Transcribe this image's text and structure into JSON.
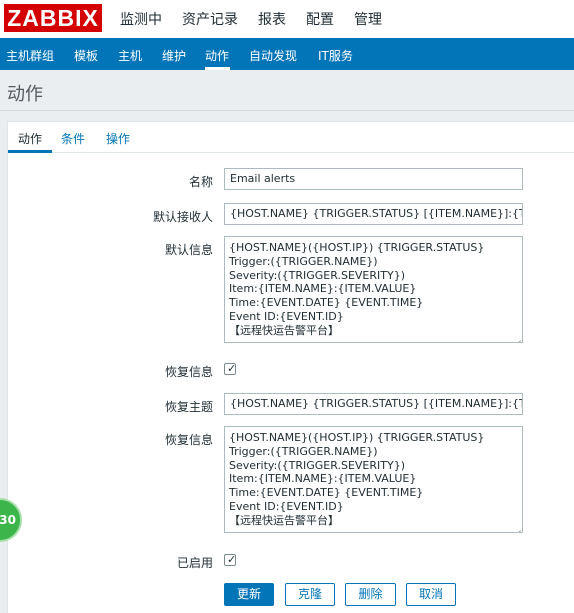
{
  "logo": "ZABBIX",
  "top_menu": [
    "监测中",
    "资产记录",
    "报表",
    "配置",
    "管理"
  ],
  "sub_menu": [
    "主机群组",
    "模板",
    "主机",
    "维护",
    "动作",
    "自动发现",
    "IT服务"
  ],
  "page_title": "动作",
  "tabs": [
    "动作",
    "条件",
    "操作"
  ],
  "form": {
    "name_label": "名称",
    "name_value": "Email alerts",
    "default_recipient_label": "默认接收人",
    "default_recipient_value": "{HOST.NAME} {TRIGGER.STATUS} [{ITEM.NAME}]:{T",
    "default_message_label": "默认信息",
    "default_message_lines": [
      "{HOST.NAME}({HOST.IP}) {TRIGGER.STATUS}",
      "Trigger:({TRIGGER.NAME})",
      "Severity:({TRIGGER.SEVERITY})",
      "Item:{ITEM.NAME}:{ITEM.VALUE}",
      "Time:{EVENT.DATE} {EVENT.TIME}",
      "Event ID:{EVENT.ID}",
      "【远程快运告警平台】"
    ],
    "recovery_message_label": "恢复信息",
    "recovery_message_checked": true,
    "recovery_subject_label": "恢复主题",
    "recovery_subject_value": "{HOST.NAME} {TRIGGER.STATUS} [{ITEM.NAME}]:{T",
    "recovery_body_label": "恢复信息",
    "recovery_body_lines": [
      "{HOST.NAME}({HOST.IP}) {TRIGGER.STATUS}",
      "Trigger:({TRIGGER.NAME})",
      "Severity:({TRIGGER.SEVERITY})",
      "Item:{ITEM.NAME}:{ITEM.VALUE}",
      "Time:{EVENT.DATE} {EVENT.TIME}",
      "Event ID:{EVENT.ID}",
      "【远程快运告警平台】"
    ],
    "enabled_label": "已启用",
    "enabled_checked": true
  },
  "buttons": {
    "update": "更新",
    "clone": "克隆",
    "delete": "删除",
    "cancel": "取消"
  },
  "badge_text": "30",
  "colors": {
    "brand": "#d40000",
    "accent": "#0275b8",
    "badge": "#3cb54a"
  }
}
